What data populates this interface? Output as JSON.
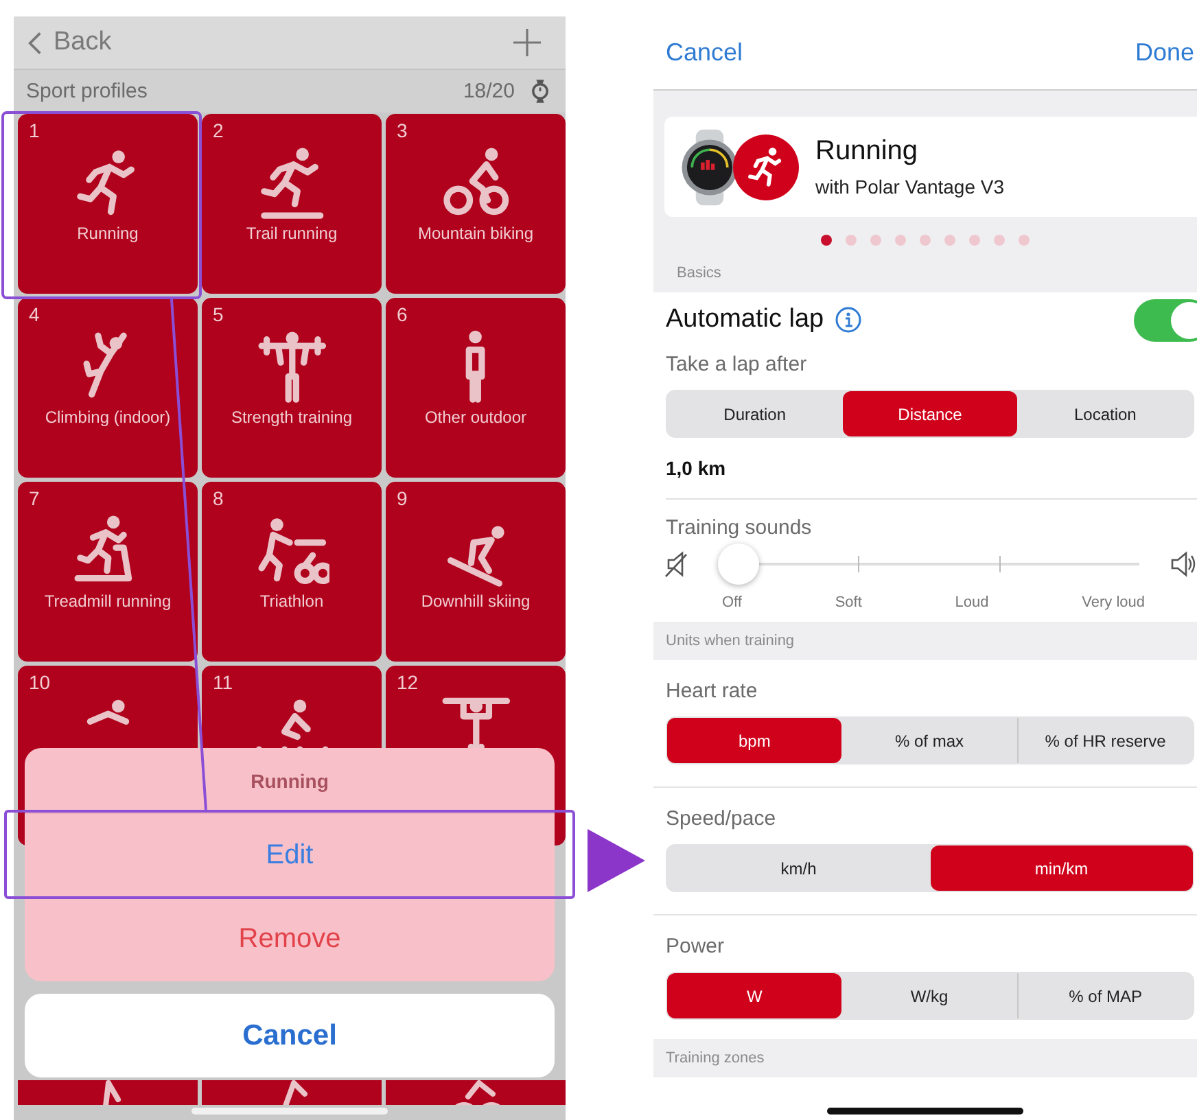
{
  "left_screen": {
    "back": "Back",
    "title": "Sport profiles",
    "count": "18/20",
    "tiles": [
      {
        "number": "1",
        "label": "Running"
      },
      {
        "number": "2",
        "label": "Trail running"
      },
      {
        "number": "3",
        "label": "Mountain biking"
      },
      {
        "number": "4",
        "label": "Climbing (indoor)"
      },
      {
        "number": "5",
        "label": "Strength training"
      },
      {
        "number": "6",
        "label": "Other outdoor"
      },
      {
        "number": "7",
        "label": "Treadmill running"
      },
      {
        "number": "8",
        "label": "Triathlon"
      },
      {
        "number": "9",
        "label": "Downhill skiing"
      },
      {
        "number": "10"
      },
      {
        "number": "11"
      },
      {
        "number": "12"
      }
    ],
    "action_sheet": {
      "title": "Running",
      "actions": [
        {
          "label": "Edit",
          "kind": "default"
        },
        {
          "label": "Remove",
          "kind": "destructive"
        }
      ],
      "cancel": "Cancel"
    }
  },
  "right_screen": {
    "cancel": "Cancel",
    "done": "Done",
    "profile": {
      "name": "Running",
      "device": "with Polar Vantage V3"
    },
    "pager": [
      {
        "selected": true
      },
      {
        "selected": false
      },
      {
        "selected": false
      },
      {
        "selected": false
      },
      {
        "selected": false
      },
      {
        "selected": false
      },
      {
        "selected": false
      },
      {
        "selected": false
      },
      {
        "selected": false
      }
    ],
    "basics_header": "Basics",
    "automatic_lap": {
      "label": "Automatic lap",
      "on": true
    },
    "lap_caption": "Take a lap after",
    "lap_options": [
      {
        "label": "Duration",
        "selected": false
      },
      {
        "label": "Distance",
        "selected": true
      },
      {
        "label": "Location",
        "selected": false
      }
    ],
    "lap_value": "1,0 km",
    "training_sounds": {
      "label": "Training sounds",
      "level": 0,
      "stops": [
        "Off",
        "Soft",
        "Loud",
        "Very loud"
      ]
    },
    "units_header": "Units when training",
    "unit_groups": [
      {
        "label": "Heart rate",
        "options": [
          {
            "label": "bpm",
            "selected": true
          },
          {
            "label": "% of max",
            "selected": false
          },
          {
            "label": "% of HR reserve",
            "selected": false
          }
        ]
      },
      {
        "label": "Speed/pace",
        "options": [
          {
            "label": "km/h",
            "selected": false
          },
          {
            "label": "min/km",
            "selected": true
          }
        ]
      },
      {
        "label": "Power",
        "options": [
          {
            "label": "W",
            "selected": true
          },
          {
            "label": "W/kg",
            "selected": false
          },
          {
            "label": "% of MAP",
            "selected": false
          }
        ]
      }
    ],
    "zones_header": "Training zones"
  }
}
